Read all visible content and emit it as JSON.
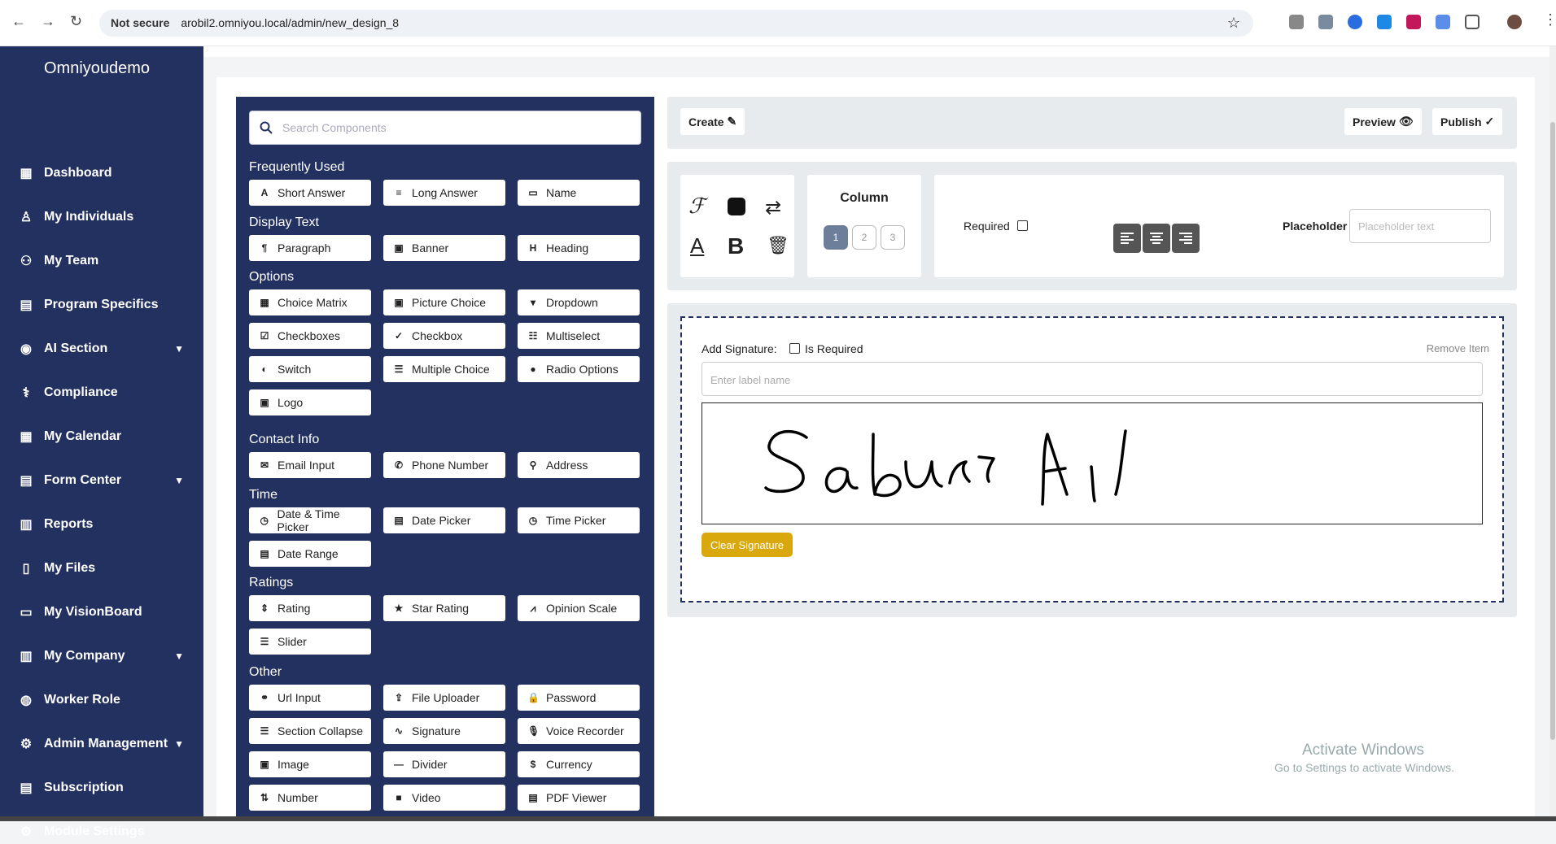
{
  "browser": {
    "not_secure": "Not secure",
    "url": "arobil2.omniyou.local/admin/new_design_8"
  },
  "sidebar": {
    "logo": "Omniyoudemo",
    "items": [
      {
        "label": "Dashboard",
        "icon": "dashboard-icon"
      },
      {
        "label": "My Individuals",
        "icon": "user-icon"
      },
      {
        "label": "My Team",
        "icon": "team-icon"
      },
      {
        "label": "Program Specifics",
        "icon": "program-icon"
      },
      {
        "label": "AI Section",
        "icon": "ai-icon",
        "expand": true
      },
      {
        "label": "Compliance",
        "icon": "compliance-icon"
      },
      {
        "label": "My Calendar",
        "icon": "calendar-icon"
      },
      {
        "label": "Form Center",
        "icon": "form-icon",
        "expand": true
      },
      {
        "label": "Reports",
        "icon": "reports-icon"
      },
      {
        "label": "My Files",
        "icon": "file-icon"
      },
      {
        "label": "My VisionBoard",
        "icon": "visionboard-icon"
      },
      {
        "label": "My Company",
        "icon": "company-icon",
        "expand": true
      },
      {
        "label": "Worker Role",
        "icon": "worker-icon"
      },
      {
        "label": "Admin Management",
        "icon": "admin-icon",
        "expand": true
      },
      {
        "label": "Subscription",
        "icon": "subscription-icon"
      },
      {
        "label": "Module Settings",
        "icon": "settings-icon"
      }
    ]
  },
  "components": {
    "search_placeholder": "Search Components",
    "sections": [
      {
        "title": "Frequently Used",
        "items": [
          {
            "label": "Short Answer",
            "icon": "A"
          },
          {
            "label": "Long Answer",
            "icon": "≡"
          },
          {
            "label": "Name",
            "icon": "▭"
          }
        ]
      },
      {
        "title": "Display Text",
        "items": [
          {
            "label": "Paragraph",
            "icon": "¶"
          },
          {
            "label": "Banner",
            "icon": "▣"
          },
          {
            "label": "Heading",
            "icon": "H"
          }
        ]
      },
      {
        "title": "Options",
        "items": [
          {
            "label": "Choice Matrix",
            "icon": "▦"
          },
          {
            "label": "Picture Choice",
            "icon": "▣"
          },
          {
            "label": "Dropdown",
            "icon": "▾"
          },
          {
            "label": "Checkboxes",
            "icon": "☑"
          },
          {
            "label": "Checkbox",
            "icon": "✓"
          },
          {
            "label": "Multiselect",
            "icon": "☷"
          },
          {
            "label": "Switch",
            "icon": "◐"
          },
          {
            "label": "Multiple Choice",
            "icon": "☰"
          },
          {
            "label": "Radio Options",
            "icon": "●"
          },
          {
            "label": "Logo",
            "icon": "▣"
          }
        ]
      },
      {
        "title": "Contact Info",
        "items": [
          {
            "label": "Email Input",
            "icon": "✉"
          },
          {
            "label": "Phone Number",
            "icon": "✆"
          },
          {
            "label": "Address",
            "icon": "⚲"
          }
        ]
      },
      {
        "title": "Time",
        "items": [
          {
            "label": "Date & Time Picker",
            "icon": "◷"
          },
          {
            "label": "Date Picker",
            "icon": "▤"
          },
          {
            "label": "Time Picker",
            "icon": "◷"
          },
          {
            "label": "Date Range",
            "icon": "▤"
          }
        ]
      },
      {
        "title": "Ratings",
        "items": [
          {
            "label": "Rating",
            "icon": "⇕"
          },
          {
            "label": "Star Rating",
            "icon": "★"
          },
          {
            "label": "Opinion Scale",
            "icon": "⩘"
          },
          {
            "label": "Slider",
            "icon": "☰"
          }
        ]
      },
      {
        "title": "Other",
        "items": [
          {
            "label": "Url Input",
            "icon": "⚭"
          },
          {
            "label": "File Uploader",
            "icon": "⇪"
          },
          {
            "label": "Password",
            "icon": "🔒"
          },
          {
            "label": "Section Collapse",
            "icon": "☰"
          },
          {
            "label": "Signature",
            "icon": "∿"
          },
          {
            "label": "Voice Recorder",
            "icon": "🎙"
          },
          {
            "label": "Image",
            "icon": "▣"
          },
          {
            "label": "Divider",
            "icon": "—"
          },
          {
            "label": "Currency",
            "icon": "$"
          },
          {
            "label": "Number",
            "icon": "⇅"
          },
          {
            "label": "Video",
            "icon": "■"
          },
          {
            "label": "PDF Viewer",
            "icon": "▤"
          }
        ]
      }
    ]
  },
  "toolbar": {
    "create": "Create",
    "preview": "Preview",
    "publish": "Publish"
  },
  "properties": {
    "column_title": "Column",
    "columns": [
      "1",
      "2",
      "3"
    ],
    "required": "Required",
    "placeholder_label": "Placeholder",
    "placeholder_hint": "Placeholder text"
  },
  "signature": {
    "label": "Add Signature:",
    "is_required": "Is Required",
    "remove": "Remove Item",
    "label_placeholder": "Enter label name",
    "clear": "Clear Signature",
    "clear_color": "#d9a80c"
  },
  "watermark": {
    "line1": "Activate Windows",
    "line2": "Go to Settings to activate Windows."
  }
}
